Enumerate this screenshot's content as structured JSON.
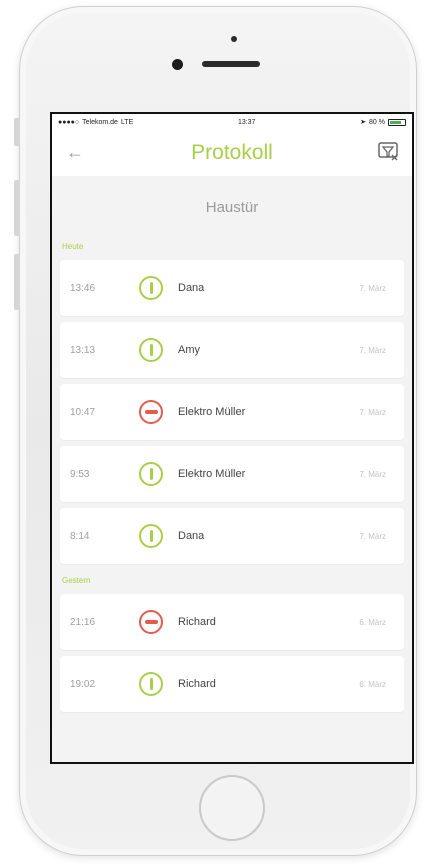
{
  "status_bar": {
    "carrier": "Telekom.de",
    "network": "LTE",
    "time": "13:37",
    "battery": "80 %",
    "battery_level": 0.8
  },
  "nav": {
    "title": "Protokoll",
    "back_icon": "arrow-left-icon",
    "filter_icon": "filter-funnel-icon"
  },
  "subheader": "Haustür",
  "colors": {
    "accent": "#a8cf48",
    "denied": "#e25b4f"
  },
  "sections": [
    {
      "label": "Heute",
      "entries": [
        {
          "time": "13:46",
          "name": "Dana",
          "date": "7. März",
          "status": "allowed"
        },
        {
          "time": "13:13",
          "name": "Amy",
          "date": "7. März",
          "status": "allowed"
        },
        {
          "time": "10:47",
          "name": "Elektro Müller",
          "date": "7. März",
          "status": "denied"
        },
        {
          "time": "9:53",
          "name": "Elektro Müller",
          "date": "7. März",
          "status": "allowed"
        },
        {
          "time": "8:14",
          "name": "Dana",
          "date": "7. März",
          "status": "allowed"
        }
      ]
    },
    {
      "label": "Gestern",
      "entries": [
        {
          "time": "21:16",
          "name": "Richard",
          "date": "6. März",
          "status": "denied"
        },
        {
          "time": "19:02",
          "name": "Richard",
          "date": "6. März",
          "status": "allowed"
        }
      ]
    }
  ]
}
